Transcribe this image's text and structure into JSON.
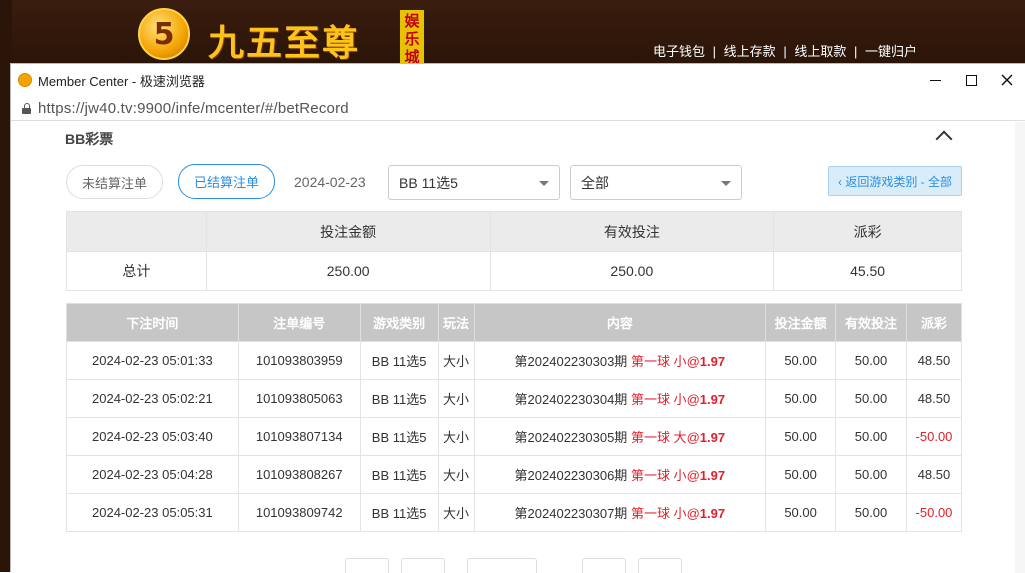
{
  "site": {
    "logo_char": "5",
    "logo_text": "九五至尊",
    "logo_tag": "娱乐城",
    "nav": [
      "电子钱包",
      "线上存款",
      "线上取款",
      "一键归户"
    ],
    "nav_sep": "|"
  },
  "window": {
    "title": "Member Center - 极速浏览器",
    "url": "https://jw40.tv:9900/infe/mcenter/#/betRecord"
  },
  "section": {
    "title": "BB彩票"
  },
  "filters": {
    "unsettled_label": "未结算注单",
    "settled_label": "已结算注单",
    "date": "2024-02-23",
    "game_select": "BB 11选5",
    "type_select": "全部",
    "back_label": "‹ 返回游戏类别 - 全部"
  },
  "summary": {
    "headers": [
      "",
      "投注金额",
      "有效投注",
      "派彩"
    ],
    "row": [
      "总计",
      "250.00",
      "250.00",
      "45.50"
    ]
  },
  "records": {
    "headers": [
      "下注时间",
      "注单编号",
      "游戏类别",
      "玩法",
      "内容",
      "投注金额",
      "有效投注",
      "派彩"
    ],
    "rows": [
      {
        "time": "2024-02-23 05:01:33",
        "id": "101093803959",
        "game": "BB 11选5",
        "play": "大小",
        "period": "第202402230303期",
        "pick": "第一球 小",
        "odds_prefix": "@",
        "odds": "1.97",
        "amount": "50.00",
        "valid": "50.00",
        "payout": "48.50"
      },
      {
        "time": "2024-02-23 05:02:21",
        "id": "101093805063",
        "game": "BB 11选5",
        "play": "大小",
        "period": "第202402230304期",
        "pick": "第一球 小",
        "odds_prefix": "@",
        "odds": "1.97",
        "amount": "50.00",
        "valid": "50.00",
        "payout": "48.50"
      },
      {
        "time": "2024-02-23 05:03:40",
        "id": "101093807134",
        "game": "BB 11选5",
        "play": "大小",
        "period": "第202402230305期",
        "pick": "第一球 大",
        "odds_prefix": "@",
        "odds": "1.97",
        "amount": "50.00",
        "valid": "50.00",
        "payout": "-50.00"
      },
      {
        "time": "2024-02-23 05:04:28",
        "id": "101093808267",
        "game": "BB 11选5",
        "play": "大小",
        "period": "第202402230306期",
        "pick": "第一球 小",
        "odds_prefix": "@",
        "odds": "1.97",
        "amount": "50.00",
        "valid": "50.00",
        "payout": "48.50"
      },
      {
        "time": "2024-02-23 05:05:31",
        "id": "101093809742",
        "game": "BB 11选5",
        "play": "大小",
        "period": "第202402230307期",
        "pick": "第一球 小",
        "odds_prefix": "@",
        "odds": "1.97",
        "amount": "50.00",
        "valid": "50.00",
        "payout": "-50.00"
      }
    ]
  },
  "colors": {
    "accent": "#2a8ee0",
    "negative": "#e0202b",
    "header_gray": "#c6c6c6"
  }
}
